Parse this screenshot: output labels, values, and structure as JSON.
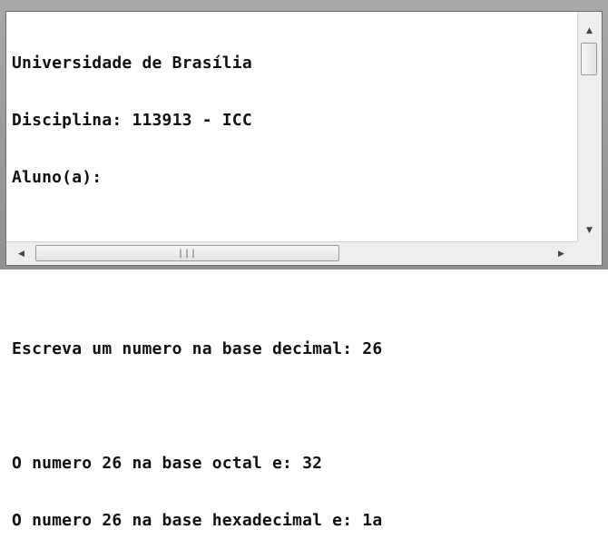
{
  "console": {
    "lines": [
      "Universidade de Brasília",
      "Disciplina: 113913 - ICC",
      "Aluno(a):",
      "",
      "",
      "Escreva um numero na base decimal: 26",
      "",
      "O numero 26 na base octal e: 32",
      "O numero 26 na base hexadecimal e: 1a"
    ]
  },
  "scrollbars": {
    "up_icon": "▲",
    "down_icon": "▼",
    "left_icon": "◀",
    "right_icon": "▶",
    "grip_icon": "|||"
  }
}
